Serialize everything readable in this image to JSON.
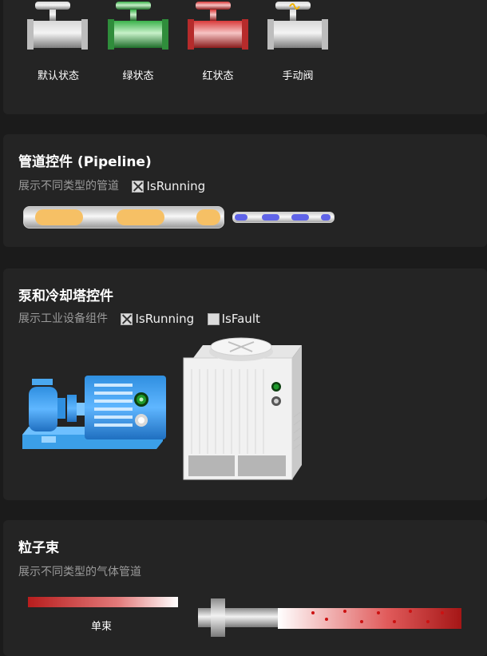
{
  "valves": {
    "items": [
      {
        "label": "默认状态",
        "color": "#9a9a9a"
      },
      {
        "label": "绿状态",
        "color": "#2e9e3c"
      },
      {
        "label": "红状态",
        "color": "#d93a3a"
      },
      {
        "label": "手动阀",
        "color": "#9a9a9a"
      }
    ]
  },
  "pipeline": {
    "title": "管道控件 (Pipeline)",
    "desc": "展示不同类型的管道",
    "is_running_label": "IsRunning",
    "is_running_checked": true,
    "fluid_color": "#f6c065",
    "gas_color": "#5f63e8"
  },
  "pump": {
    "title": "泵和冷却塔控件",
    "desc": "展示工业设备组件",
    "is_running_label": "IsRunning",
    "is_running_checked": true,
    "is_fault_label": "IsFault",
    "is_fault_checked": false,
    "pump_color": "#3aa3f0",
    "running_light": "#1f9a2c"
  },
  "beam": {
    "title": "粒子束",
    "desc": "展示不同类型的气体管道",
    "single_label": "单束",
    "beam_color": "#b81d1d"
  }
}
